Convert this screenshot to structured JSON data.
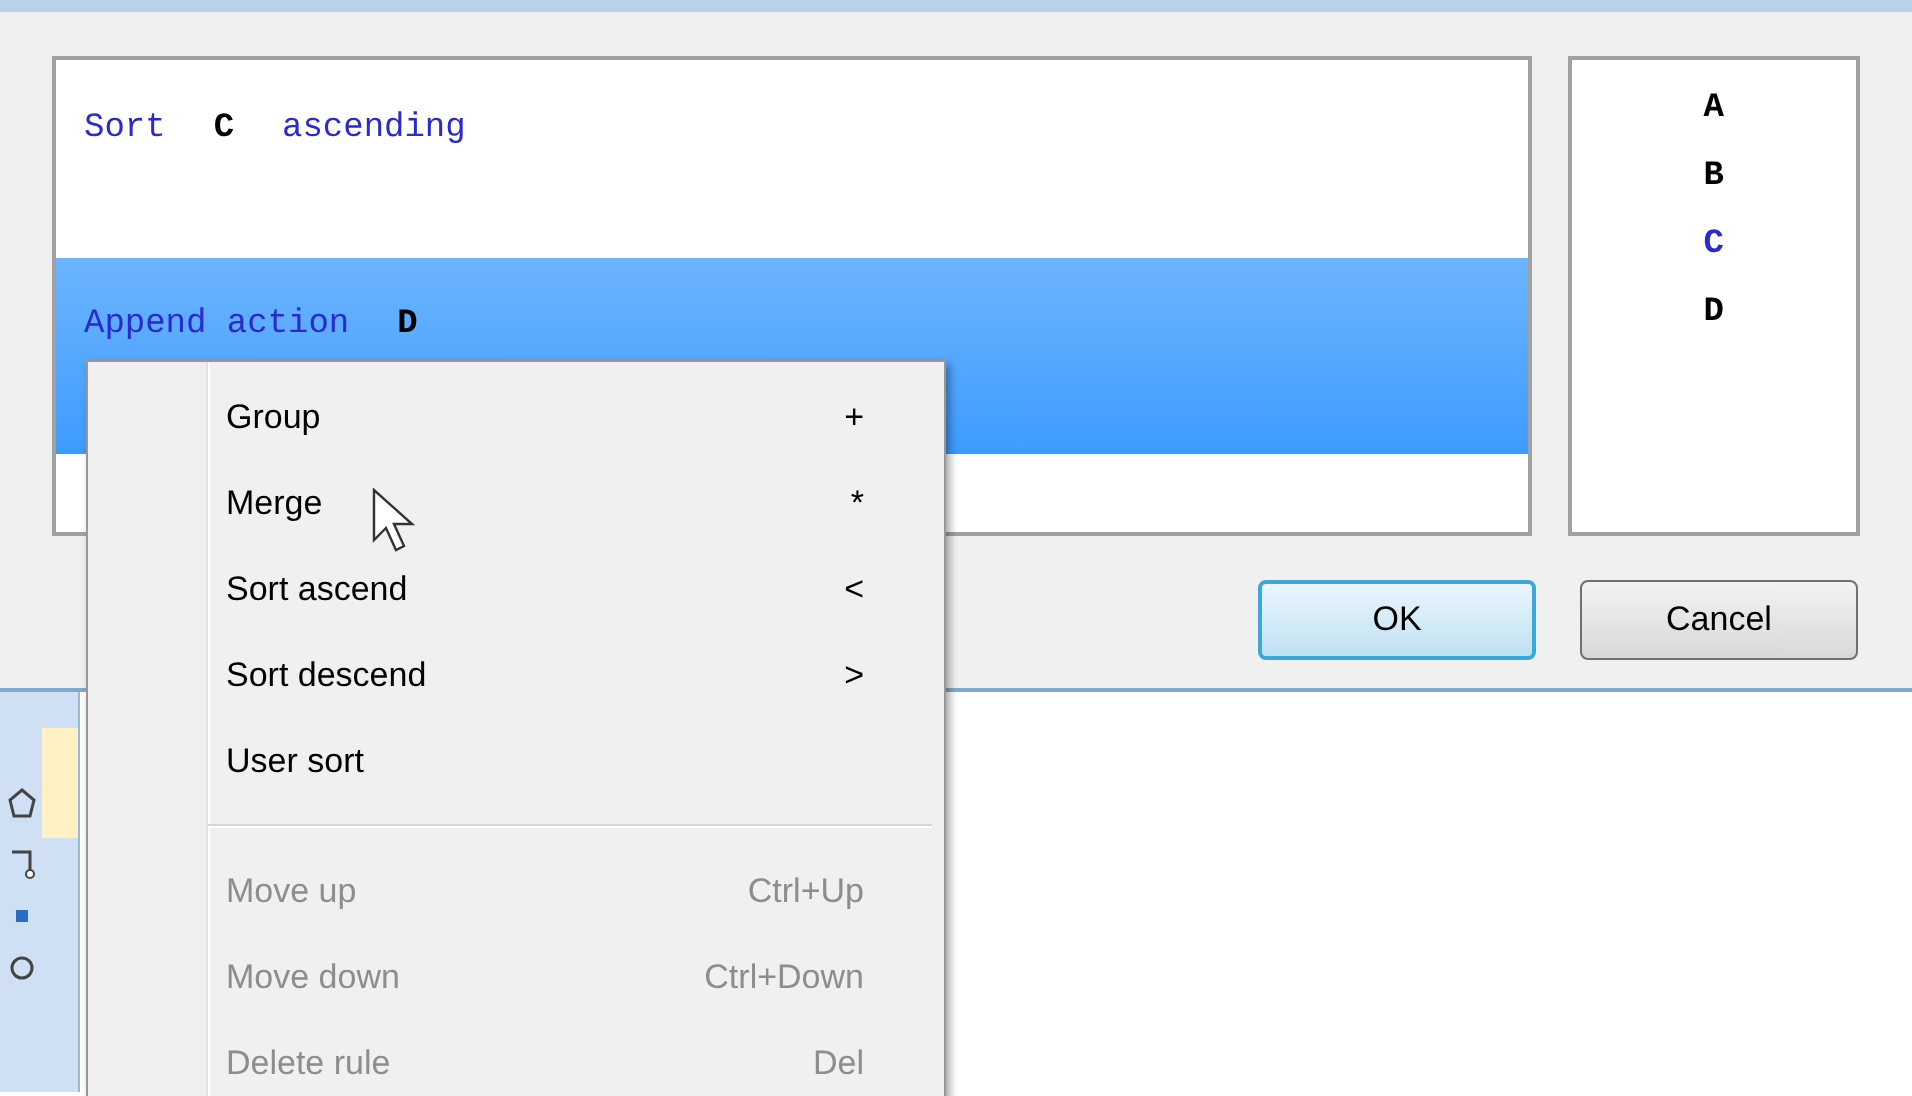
{
  "rules": [
    {
      "selected": false,
      "parts": [
        {
          "kind": "keyword",
          "text": "Sort"
        },
        {
          "kind": "field",
          "text": "C"
        },
        {
          "kind": "keyword",
          "text": "ascending"
        }
      ]
    },
    {
      "selected": true,
      "parts": [
        {
          "kind": "keyword",
          "text": "Append action"
        },
        {
          "kind": "field",
          "text": "D"
        }
      ]
    }
  ],
  "fields": [
    {
      "name": "A",
      "selected": false
    },
    {
      "name": "B",
      "selected": false
    },
    {
      "name": "C",
      "selected": true
    },
    {
      "name": "D",
      "selected": false
    }
  ],
  "buttons": [
    {
      "label": "OK",
      "kind": "default"
    },
    {
      "label": "Cancel",
      "kind": "normal"
    }
  ],
  "context_menu": [
    {
      "kind": "item",
      "label": "Group",
      "shortcut": "+",
      "disabled": false
    },
    {
      "kind": "item",
      "label": "Merge",
      "shortcut": "*",
      "disabled": false
    },
    {
      "kind": "item",
      "label": "Sort ascend",
      "shortcut": "<",
      "disabled": false
    },
    {
      "kind": "item",
      "label": "Sort descend",
      "shortcut": ">",
      "disabled": false
    },
    {
      "kind": "item",
      "label": "User sort",
      "disabled": false
    },
    {
      "kind": "separator"
    },
    {
      "kind": "item",
      "label": "Move up",
      "shortcut": "Ctrl+Up",
      "disabled": true
    },
    {
      "kind": "item",
      "label": "Move down",
      "shortcut": "Ctrl+Down",
      "disabled": true
    },
    {
      "kind": "item",
      "label": "Delete rule",
      "shortcut": "Del",
      "disabled": true
    }
  ]
}
